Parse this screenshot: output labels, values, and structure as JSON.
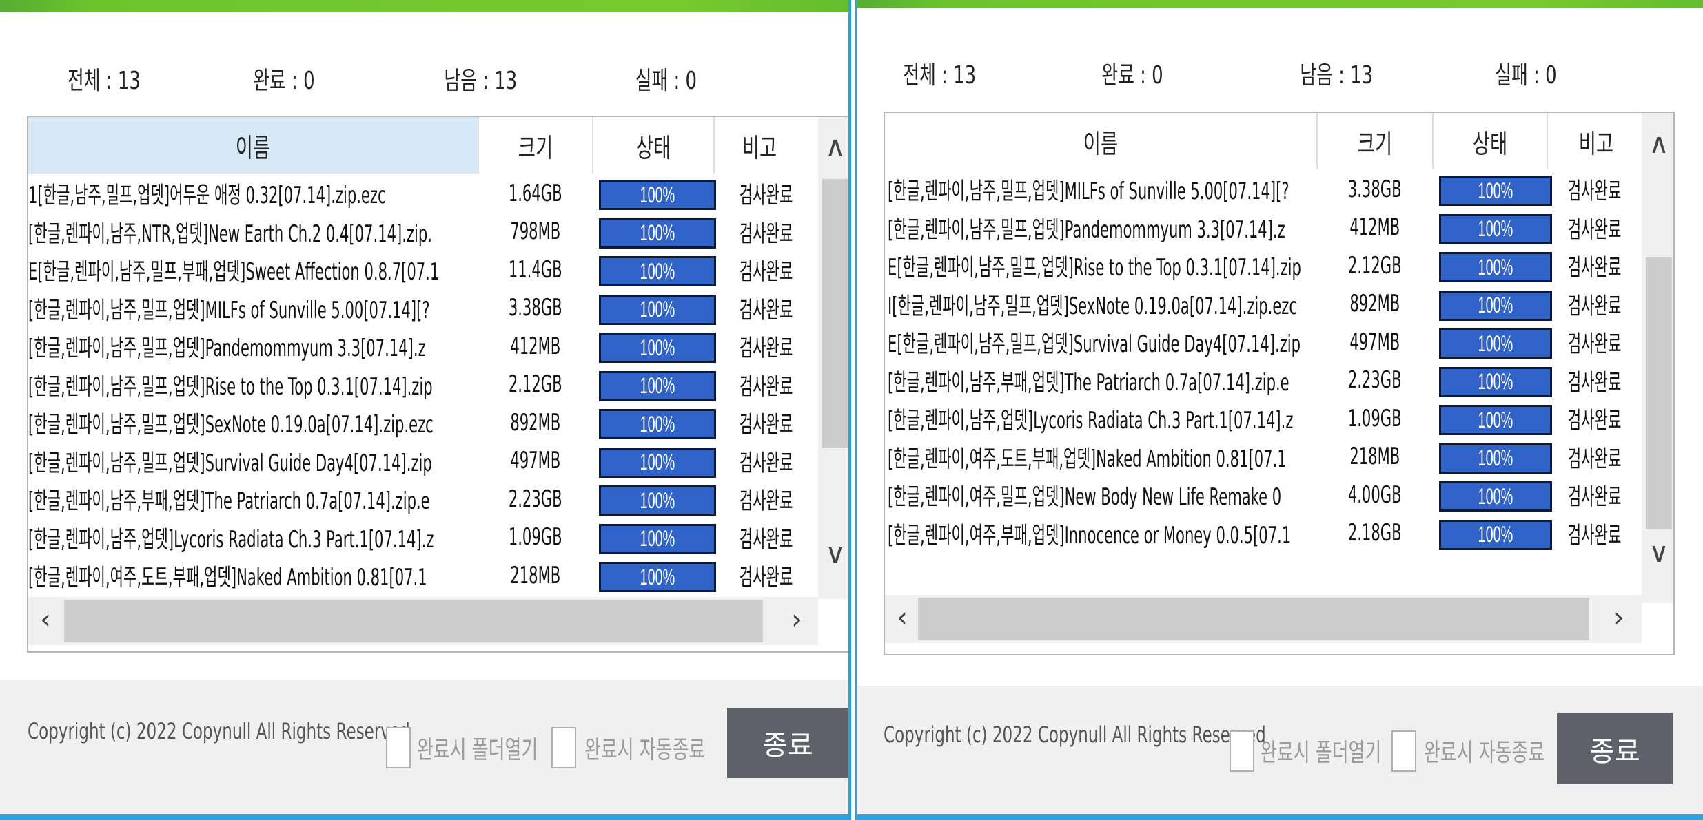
{
  "left": {
    "stats": {
      "total": "전체 : 13",
      "done": "완료 : 0",
      "remaining": "남음 : 13",
      "failed": "실패 : 0"
    },
    "columns": {
      "name": "이름",
      "size": "크기",
      "status": "상태",
      "note": "비고"
    },
    "rows": [
      {
        "name": "1[한글,남주,밀프,업뎃]어두운 애정 0.32[07.14].zip.ezc",
        "size": "1.64GB",
        "status": "100%",
        "note": "검사완료"
      },
      {
        "name": " [한글,렌파이,남주,NTR,업뎃]New Earth Ch.2 0.4[07.14].zip.",
        "size": "798MB",
        "status": "100%",
        "note": "검사완료"
      },
      {
        "name": "E[한글,렌파이,남주,밀프,부패,업뎃]Sweet Affection 0.8.7[07.1",
        "size": "11.4GB",
        "status": "100%",
        "note": "검사완료"
      },
      {
        "name": " [한글,렌파이,남주,밀프,업뎃]MILFs of Sunville 5.00[07.14][?",
        "size": "3.38GB",
        "status": "100%",
        "note": "검사완료"
      },
      {
        "name": " [한글,렌파이,남주,밀프,업뎃]Pandemommyum 3.3[07.14].z",
        "size": "412MB",
        "status": "100%",
        "note": "검사완료"
      },
      {
        "name": " [한글,렌파이,남주,밀프,업뎃]Rise to the Top 0.3.1[07.14].zip",
        "size": "2.12GB",
        "status": "100%",
        "note": "검사완료"
      },
      {
        "name": " [한글,렌파이,남주,밀프,업뎃]SexNote 0.19.0a[07.14].zip.ezc",
        "size": "892MB",
        "status": "100%",
        "note": "검사완료"
      },
      {
        "name": " [한글,렌파이,남주,밀프,업뎃]Survival Guide Day4[07.14].zip",
        "size": "497MB",
        "status": "100%",
        "note": "검사완료"
      },
      {
        "name": " [한글,렌파이,남주,부패,업뎃]The Patriarch 0.7a[07.14].zip.e",
        "size": "2.23GB",
        "status": "100%",
        "note": "검사완료"
      },
      {
        "name": " [한글,렌파이,남주,업뎃]Lycoris Radiata Ch.3 Part.1[07.14].z",
        "size": "1.09GB",
        "status": "100%",
        "note": "검사완료"
      },
      {
        "name": " [한글,렌파이,여주,도트,부패,업뎃]Naked Ambition 0.81[07.1",
        "size": "218MB",
        "status": "100%",
        "note": "검사완료"
      }
    ],
    "arrows": {
      "up": "∧",
      "down": "∨",
      "left": "‹",
      "right": "›"
    },
    "copyright": "Copyright (c) 2022 Copynull All Rights Reserved",
    "open_folder_label": "완료시 폴더열기",
    "auto_exit_label": "완료시 자동종료",
    "close_label": "종료"
  },
  "right": {
    "stats": {
      "total": "전체 : 13",
      "done": "완료 : 0",
      "remaining": "남음 : 13",
      "failed": "실패 : 0"
    },
    "columns": {
      "name": "이름",
      "size": "크기",
      "status": "상태",
      "note": "비고"
    },
    "rows": [
      {
        "name": " [한글,렌파이,남주,밀프,업뎃]MILFs of Sunville 5.00[07.14][?",
        "size": "3.38GB",
        "status": "100%",
        "note": "검사완료"
      },
      {
        "name": " [한글,렌파이,남주,밀프,업뎃]Pandemommyum 3.3[07.14].z",
        "size": "412MB",
        "status": "100%",
        "note": "검사완료"
      },
      {
        "name": "E[한글,렌파이,남주,밀프,업뎃]Rise to the Top 0.3.1[07.14].zip",
        "size": "2.12GB",
        "status": "100%",
        "note": "검사완료"
      },
      {
        "name": "I[한글,렌파이,남주,밀프,업뎃]SexNote 0.19.0a[07.14].zip.ezc",
        "size": "892MB",
        "status": "100%",
        "note": "검사완료"
      },
      {
        "name": "E[한글,렌파이,남주,밀프,업뎃]Survival Guide Day4[07.14].zip",
        "size": "497MB",
        "status": "100%",
        "note": "검사완료"
      },
      {
        "name": " [한글,렌파이,남주,부패,업뎃]The Patriarch 0.7a[07.14].zip.e",
        "size": "2.23GB",
        "status": "100%",
        "note": "검사완료"
      },
      {
        "name": " [한글,렌파이,남주,업뎃]Lycoris Radiata Ch.3 Part.1[07.14].z",
        "size": "1.09GB",
        "status": "100%",
        "note": "검사완료"
      },
      {
        "name": " [한글,렌파이,여주,도트,부패,업뎃]Naked Ambition 0.81[07.1",
        "size": "218MB",
        "status": "100%",
        "note": "검사완료"
      },
      {
        "name": " [한글,렌파이,여주,밀프,업뎃]New Body New Life Remake 0",
        "size": "4.00GB",
        "status": "100%",
        "note": "검사완료"
      },
      {
        "name": " [한글,렌파이,여주,부패,업뎃]Innocence or Money 0.0.5[07.1",
        "size": "2.18GB",
        "status": "100%",
        "note": "검사완료"
      }
    ],
    "arrows": {
      "up": "∧",
      "down": "∨",
      "left": "‹",
      "right": "›"
    },
    "copyright": "Copyright (c) 2022 Copynull All Rights Reserved",
    "open_folder_label": "완료시 폴더열기",
    "auto_exit_label": "완료시 자동종료",
    "close_label": "종료"
  },
  "colors": {
    "accent_blue": "#2aa3e2",
    "progress_fill": "#2f63c7",
    "title_green": "#77ca2e",
    "button_gray": "#5e6169"
  }
}
